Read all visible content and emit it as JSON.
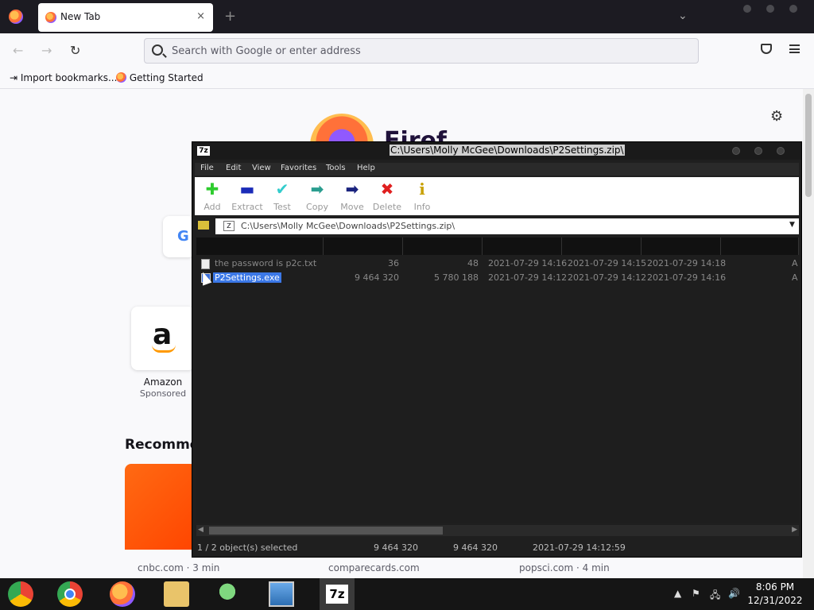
{
  "browser": {
    "tab_title": "New Tab",
    "tab_close": "×",
    "new_tab": "+",
    "url_placeholder": "Search with Google or enter address",
    "bookmarks": [
      {
        "label": "Import bookmarks..."
      },
      {
        "label": "Getting Started"
      }
    ]
  },
  "newtab_page": {
    "wordmark": "Firef",
    "google_letter": "G",
    "amazon_tile": {
      "letter": "a",
      "label": "Amazon",
      "sponsored": "Sponsored"
    },
    "recommended_heading": "Recommen",
    "story_sources": [
      "cnbc.com · 3 min",
      "comparecards.com",
      "popsci.com · 4 min"
    ]
  },
  "sevenzip": {
    "app_icon": "7z",
    "title": "C:\\Users\\Molly McGee\\Downloads\\P2Settings.zip\\",
    "menu": [
      "File",
      "Edit",
      "View",
      "Favorites",
      "Tools",
      "Help"
    ],
    "toolbar": [
      {
        "label": "Add",
        "icon": "plus-icon",
        "glyph": "✚",
        "color": "#2ecc2e"
      },
      {
        "label": "Extract",
        "icon": "minus-icon",
        "glyph": "▬",
        "color": "#1a2bb8"
      },
      {
        "label": "Test",
        "icon": "check-icon",
        "glyph": "✔",
        "color": "#33cccc"
      },
      {
        "label": "Copy",
        "icon": "copy-arrow-icon",
        "glyph": "➡",
        "color": "#2a9d8f"
      },
      {
        "label": "Move",
        "icon": "move-arrow-icon",
        "glyph": "➡",
        "color": "#1a237e"
      },
      {
        "label": "Delete",
        "icon": "delete-x-icon",
        "glyph": "✖",
        "color": "#e01f1f"
      },
      {
        "label": "Info",
        "icon": "info-icon",
        "glyph": "i",
        "color": "#c8a000"
      }
    ],
    "address": "C:\\Users\\Molly McGee\\Downloads\\P2Settings.zip\\",
    "files": [
      {
        "name": "the password is p2c.txt",
        "size": "36",
        "packed": "48",
        "modified": "2021-07-29 14:16",
        "created": "2021-07-29 14:15",
        "accessed": "2021-07-29 14:18",
        "attr": "A",
        "selected": false
      },
      {
        "name": "P2Settings.exe",
        "size": "9 464 320",
        "packed": "5 780 188",
        "modified": "2021-07-29 14:12",
        "created": "2021-07-29 14:12",
        "accessed": "2021-07-29 14:16",
        "attr": "A",
        "selected": true
      }
    ],
    "status": {
      "selected": "1 / 2 object(s) selected",
      "size": "9 464 320",
      "packed": "9 464 320",
      "modified": "2021-07-29 14:12:59"
    }
  },
  "taskbar": {
    "active_label": "7z",
    "time": "8:06 PM",
    "date": "12/31/2022"
  }
}
